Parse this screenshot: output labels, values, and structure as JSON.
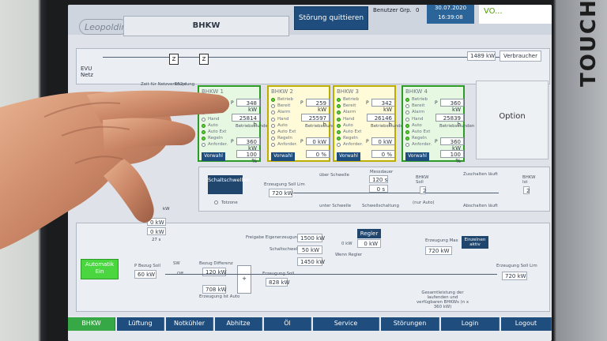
{
  "device": {
    "bezel_label": "TOUCH"
  },
  "header": {
    "logo": "Leopoldina",
    "page_title": "BHKW",
    "quit_button": "Störung quittieren",
    "user_label": "Benutzer Grp.",
    "user_value": "0",
    "date": "30.07.2020",
    "time": "16:39:08",
    "brand": "VO..."
  },
  "flow": {
    "evu": "EVU Netz",
    "z1": "Z",
    "z2": "Z",
    "consumer_value": "1489 kW",
    "consumer_label": "Verbraucher",
    "header_text": "Zeit für Netzverknüpfung",
    "value_6524": "652 s",
    "ev_label": "Freigabe Eigen- erzeugung von EVU"
  },
  "plants": [
    {
      "title": "BHKW 1",
      "power": "348 kW",
      "hours": "25814 h",
      "setpoint_kw": "360 kW",
      "setpoint_pct": "100 %",
      "mode": "Vorwahl",
      "statuses": [
        "Betrieb",
        "Bereit",
        "Alarm",
        "Hand",
        "Auto",
        "Auto Ext",
        "Regeln",
        "Anforder."
      ],
      "active": [
        0,
        4,
        5,
        6
      ]
    },
    {
      "title": "BHKW 2",
      "power": "259 kW",
      "hours": "25597 h",
      "setpoint_kw": "0 kW",
      "setpoint_pct": "0 %",
      "mode": "Vorwahl",
      "statuses": [
        "Betrieb",
        "Bereit",
        "Alarm",
        "Hand",
        "Auto",
        "Auto Ext",
        "Regeln",
        "Anforder."
      ],
      "active": [
        0
      ]
    },
    {
      "title": "BHKW 3",
      "power": "342 kW",
      "hours": "26146 h",
      "setpoint_kw": "0 kW",
      "setpoint_pct": "0 %",
      "mode": "Vorwahl",
      "statuses": [
        "Betrieb",
        "Bereit",
        "Alarm",
        "Hand",
        "Auto",
        "Auto Ext",
        "Regeln",
        "Anforder."
      ],
      "active": [
        0,
        1,
        2,
        3,
        4,
        5,
        6
      ]
    },
    {
      "title": "BHKW 4",
      "power": "360 kW",
      "hours": "25839 h",
      "setpoint_kw": "360 kW",
      "setpoint_pct": "100 %",
      "mode": "Vorwahl",
      "statuses": [
        "Betrieb",
        "Bereit",
        "Alarm",
        "Hand",
        "Auto",
        "Auto Ext",
        "Regeln",
        "Anforder."
      ],
      "active": [
        0,
        4,
        5,
        6
      ]
    }
  ],
  "labels": {
    "operating_hours": "Betriebsstunden",
    "p": "P",
    "ist": "Ist",
    "soll": "Soll",
    "option": "Option"
  },
  "thresholds": {
    "button": "Schaltschwellen",
    "totzone": "Totzone",
    "soll_lim": "Erzeugung Soll Lim",
    "soll_lim_value": "720 kW",
    "over": "über Schwelle",
    "under": "unter Schwelle",
    "mess": "Messdauer",
    "mess_value": "120 s",
    "mess_time": "0 s",
    "switch": "Schwellschaltung",
    "bhkw_soll": "BHKW Soll",
    "bhkw_soll_value": "2",
    "auto_only": "(nur Auto)",
    "zu": "Zuschalten läuft",
    "ab": "Abschalten läuft",
    "bhkw_ist": "BHKW Ist",
    "bhkw_ist_value": "2"
  },
  "control": {
    "automatik": "Automatik Ein",
    "bezug_soll": "60 kW",
    "bezug_diff_label": "Bezug Differenz",
    "bezug_diff": "120 kW",
    "p_label": "P Bezug Soll",
    "off": "Off",
    "sw": "SW",
    "ev_value": "1500 kW",
    "schalt_value": "50 kW",
    "minus_value": "1450 kW",
    "ev_label": "Freigabe Eigenerzeugung von EVU",
    "schalt_label": "Schaltschwelle",
    "regler": "Regler",
    "regler_value": "0 kW",
    "zero": "0 kW",
    "wenn": "Wenn Regler",
    "max_label": "Erzeugung Max",
    "max_value": "720 kW",
    "einzeln": "Einzelnen aktiv",
    "soll_value": "828 kW",
    "soll_label": "Erzeugung Soll",
    "ist_auto": "708 kW",
    "ist_auto_label": "Erzeugung Ist Auto",
    "lim_label": "Erzeugung Soll Lim",
    "lim_value": "720 kW",
    "sum_label": "Gesamtleistung der laufenden und verfügbaren BHKWs (n x 360 kW)",
    "side_kw_1": "kW",
    "side_kw_2": "0 kW",
    "side_kw_3": "0 kW",
    "side_value": "27 s"
  },
  "nav": [
    {
      "label": "BHKW"
    },
    {
      "label": "Lüftung"
    },
    {
      "label": "Notkühler"
    },
    {
      "label": "Abhitze"
    },
    {
      "label": "Öl"
    },
    {
      "label": "Service"
    },
    {
      "label": "Störungen"
    },
    {
      "label": "Login"
    },
    {
      "label": "Logout"
    }
  ],
  "colors": {
    "active_green": "#49d63f",
    "warning_yellow": "#fff45a",
    "nav_blue": "#1f4d7d"
  }
}
